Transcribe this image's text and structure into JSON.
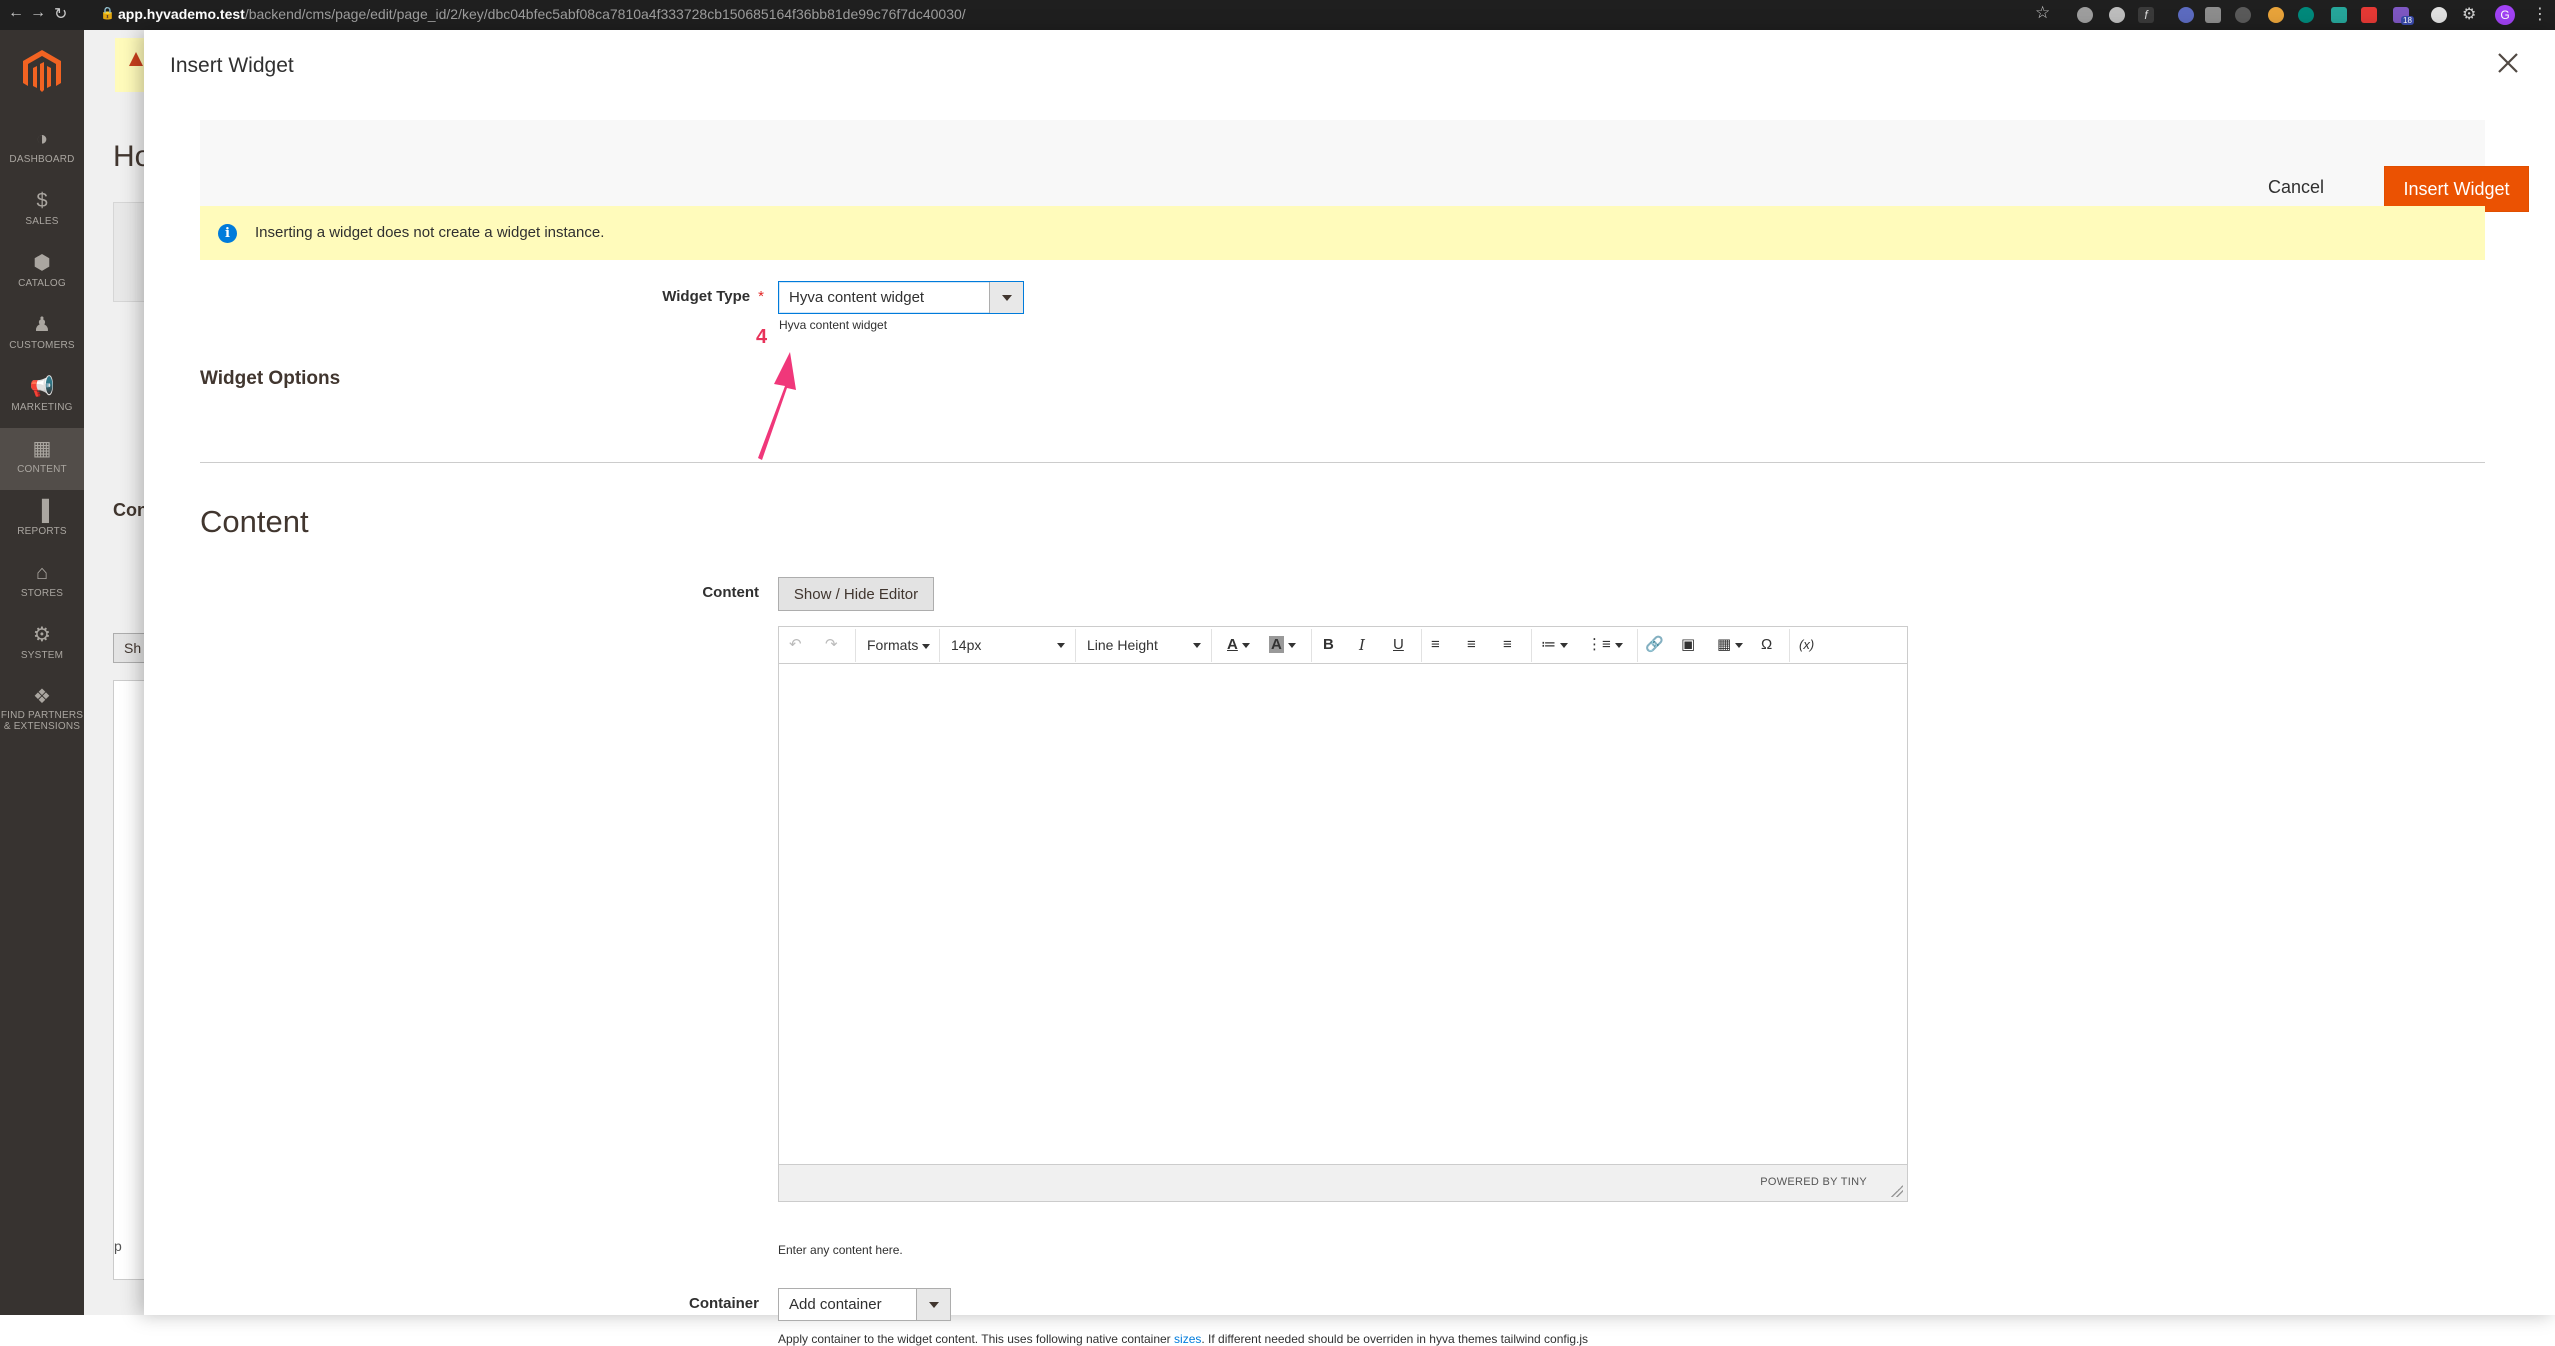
{
  "browser": {
    "url_host": "app.hyvademo.test",
    "url_path": "/backend/cms/page/edit/page_id/2/key/dbc04bfec5abf08ca7810a4f333728cb150685164f36bb81de99c76f7dc40030/",
    "profile_initial": "G",
    "extension_badge": "18"
  },
  "sidebar": {
    "items": [
      {
        "label": "DASHBOARD",
        "icon": "dashboard-icon"
      },
      {
        "label": "SALES",
        "icon": "dollar-icon"
      },
      {
        "label": "CATALOG",
        "icon": "box-icon"
      },
      {
        "label": "CUSTOMERS",
        "icon": "person-icon"
      },
      {
        "label": "MARKETING",
        "icon": "megaphone-icon"
      },
      {
        "label": "CONTENT",
        "icon": "layout-icon"
      },
      {
        "label": "REPORTS",
        "icon": "bar-chart-icon"
      },
      {
        "label": "STORES",
        "icon": "store-icon"
      },
      {
        "label": "SYSTEM",
        "icon": "gear-icon"
      },
      {
        "label_line1": "FIND PARTNERS",
        "label_line2": "& EXTENSIONS",
        "icon": "partners-icon"
      }
    ]
  },
  "background_page": {
    "title_fragment": "Ho",
    "section_fragment": "Con",
    "button_fragment": "Sh",
    "p_tag": "p"
  },
  "modal": {
    "title": "Insert Widget",
    "cancel_label": "Cancel",
    "insert_label": "Insert Widget",
    "notice": "Inserting a widget does not create a widget instance.",
    "widget_type": {
      "label": "Widget Type",
      "required_mark": "*",
      "value": "Hyva content widget",
      "note": "Hyva content widget"
    },
    "annotation_number": "4",
    "widget_options_title": "Widget Options",
    "content_section_title": "Content",
    "content_field": {
      "label": "Content",
      "show_hide_label": "Show / Hide Editor",
      "note": "Enter any content here."
    },
    "editor": {
      "formats": "Formats",
      "font_size": "14px",
      "line_height": "Line Height",
      "powered_by": "POWERED BY TINY"
    },
    "container_field": {
      "label": "Container",
      "value": "Add container",
      "note_before": "Apply container to the widget content. This uses following native container",
      "note_link": "sizes",
      "note_after": ". If different needed should be overriden in hyva themes tailwind config.js"
    }
  },
  "colors": {
    "accent_orange": "#eb5202",
    "notice_yellow": "#fffbbb",
    "info_blue": "#007bdb",
    "annotation_pink": "#e8335a",
    "sidebar_bg": "#373330"
  }
}
